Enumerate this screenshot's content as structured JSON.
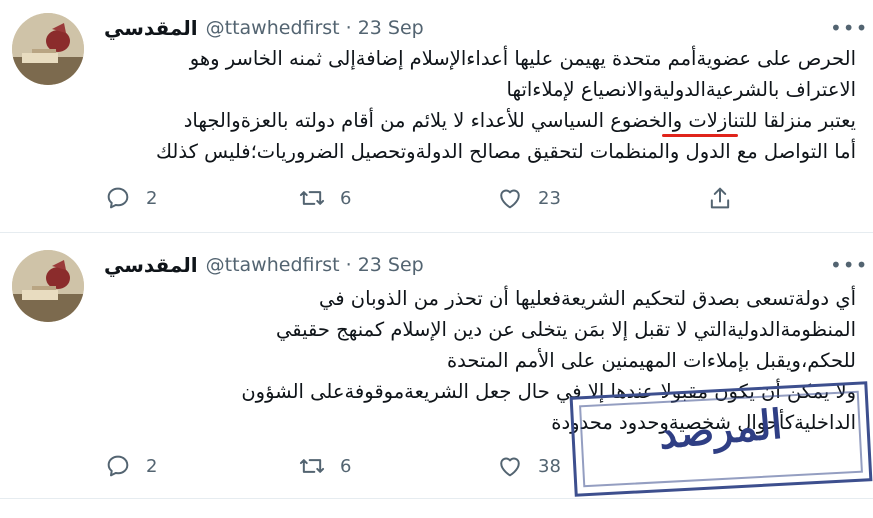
{
  "tweets": [
    {
      "display_name": "المقدسي",
      "handle": "@ttawhedfirst",
      "separator": "·",
      "date": "23 Sep",
      "more_icon": "more-horizontal-icon",
      "lines": [
        "الحرص على عضويةأمم متحدة يهيمن عليها أعداءالإسلام إضافةإلى ثمنه الخاسر وهو",
        "الاعتراف بالشرعيةالدوليةوالانصياع لإملاءاتها",
        "يعتبر منزلقا للتنازلات والخضوع السياسي للأعداء لا يلائم من أقام دولته بالعزةوالجهاد",
        "أما التواصل مع الدول والمنظمات لتحقيق مصالح الدولةوتحصيل الضروريات؛فليس كذلك"
      ],
      "replies": "2",
      "retweets": "6",
      "likes": "23"
    },
    {
      "display_name": "المقدسي",
      "handle": "@ttawhedfirst",
      "separator": "·",
      "date": "23 Sep",
      "more_icon": "more-horizontal-icon",
      "lines": [
        "أي دولةتسعى بصدق لتحكيم الشريعةفعليها أن تحذر من الذوبان في",
        "المنظومةالدوليةالتي لا تقبل إلا بمَن يتخلى عن دين الإسلام كمنهج حقيقي",
        "للحكم،ويقبل بإملاءات المهيمنين على الأمم المتحدة",
        "ولا يمكن أن يكون مقبولا عندها إلا في حال جعل الشريعةموقوفةعلى الشؤون",
        "الداخليةكأحوال شخصيةوحدود محدودة"
      ],
      "replies": "2",
      "retweets": "6",
      "likes": "38"
    }
  ],
  "stamp": {
    "text": "المرصد",
    "color": "#2f3e84"
  },
  "colors": {
    "secondary_text": "#536471",
    "highlight": "#e0241b",
    "divider": "#e6ecf0"
  }
}
